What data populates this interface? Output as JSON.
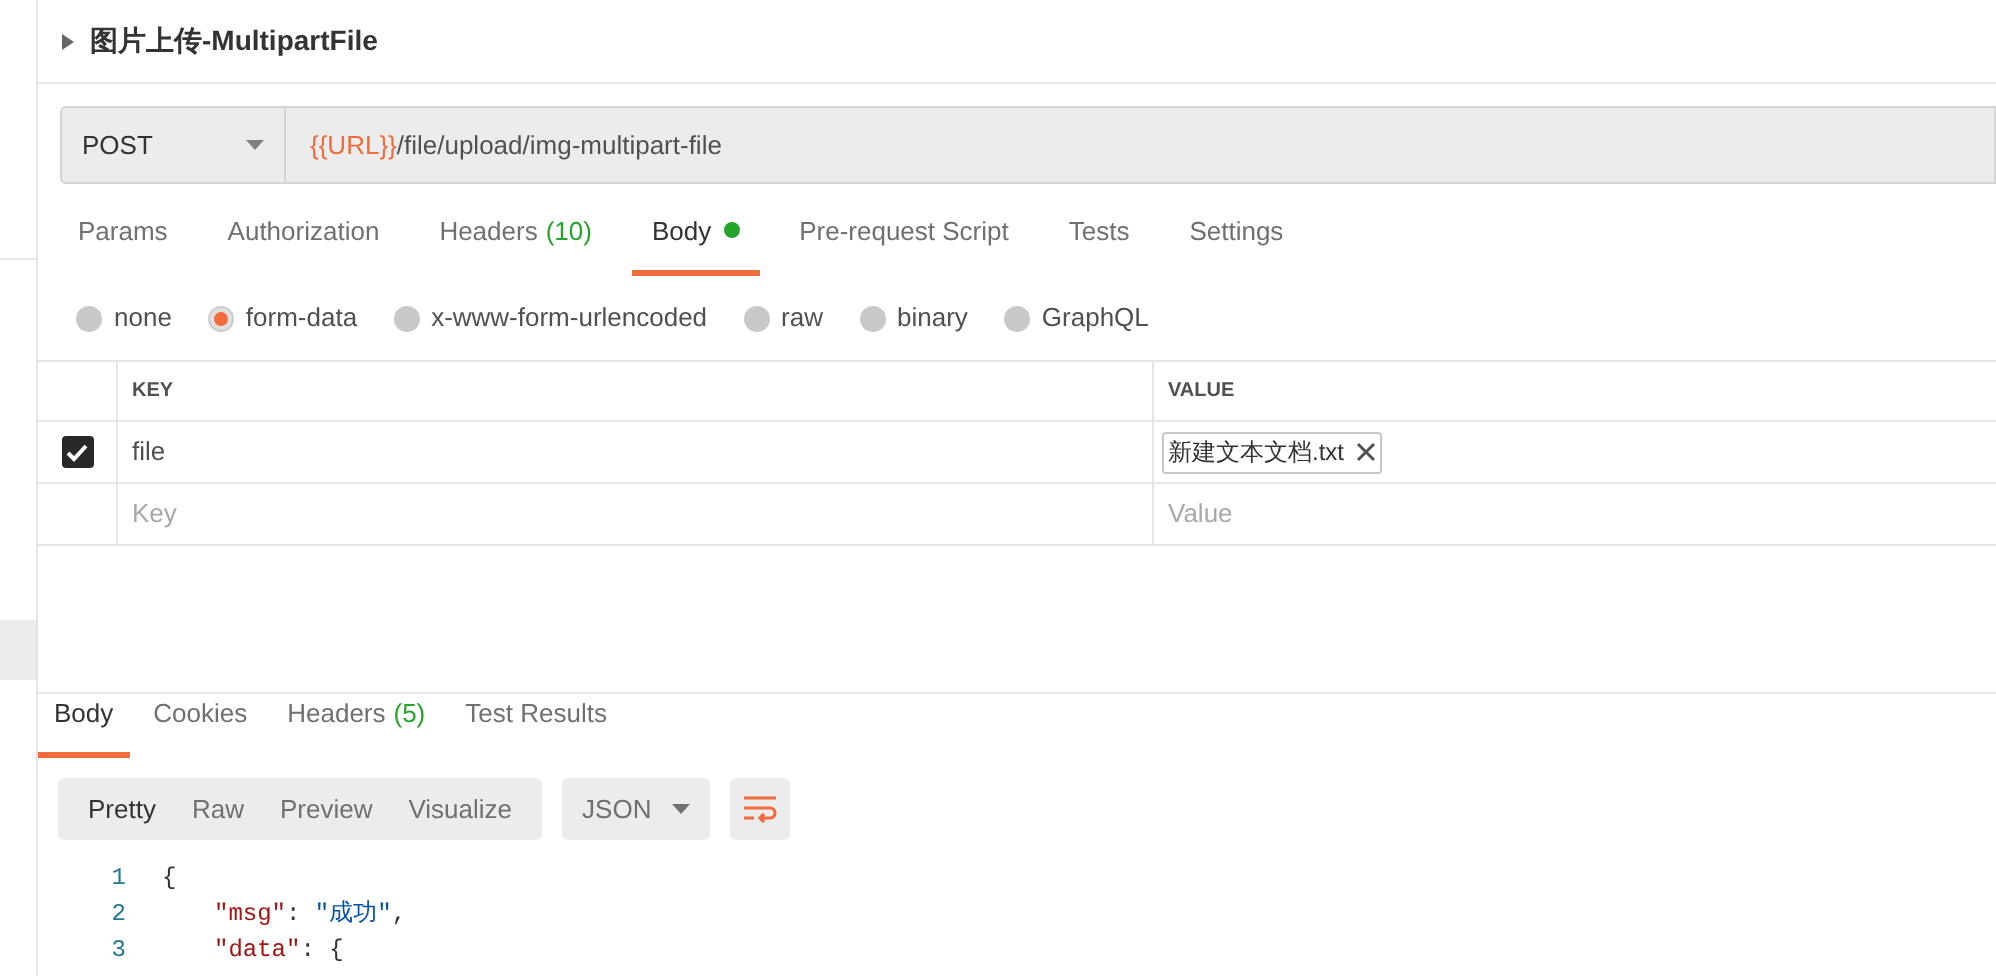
{
  "request": {
    "title": "图片上传-MultipartFile",
    "method": "POST",
    "url_variable": "{{URL}}",
    "url_path": "/file/upload/img-multipart-file"
  },
  "tabs": [
    {
      "label": "Params",
      "selected": false,
      "dot": false
    },
    {
      "label": "Authorization",
      "selected": false,
      "dot": false
    },
    {
      "label": "Headers",
      "count": "(10)",
      "selected": false,
      "dot": false
    },
    {
      "label": "Body",
      "selected": true,
      "dot": true
    },
    {
      "label": "Pre-request Script",
      "selected": false,
      "dot": false
    },
    {
      "label": "Tests",
      "selected": false,
      "dot": false
    },
    {
      "label": "Settings",
      "selected": false,
      "dot": false
    }
  ],
  "body_types": [
    {
      "label": "none",
      "selected": false
    },
    {
      "label": "form-data",
      "selected": true
    },
    {
      "label": "x-www-form-urlencoded",
      "selected": false
    },
    {
      "label": "raw",
      "selected": false
    },
    {
      "label": "binary",
      "selected": false
    },
    {
      "label": "GraphQL",
      "selected": false
    }
  ],
  "table": {
    "columns": [
      "KEY",
      "VALUE"
    ],
    "rows": [
      {
        "checked": true,
        "key": "file",
        "file": "新建文本文档.txt"
      }
    ],
    "new_row": {
      "key_placeholder": "Key",
      "value_placeholder": "Value"
    }
  },
  "response": {
    "tabs": [
      {
        "label": "Body",
        "selected": true
      },
      {
        "label": "Cookies",
        "selected": false
      },
      {
        "label": "Headers",
        "count": "(5)",
        "selected": false
      },
      {
        "label": "Test Results",
        "selected": false
      }
    ],
    "views": [
      {
        "label": "Pretty",
        "selected": true
      },
      {
        "label": "Raw",
        "selected": false
      },
      {
        "label": "Preview",
        "selected": false
      },
      {
        "label": "Visualize",
        "selected": false
      }
    ],
    "format": "JSON",
    "code": [
      {
        "number": "1",
        "tokens": [
          {
            "kind": "punct",
            "text": "{"
          }
        ]
      },
      {
        "number": "2",
        "tokens": [
          {
            "kind": "key",
            "text": "\"msg\""
          },
          {
            "kind": "punct",
            "text": ": "
          },
          {
            "kind": "string",
            "text": "\"成功\""
          },
          {
            "kind": "punct",
            "text": ","
          }
        ]
      },
      {
        "number": "3",
        "tokens": [
          {
            "kind": "key",
            "text": "\"data\""
          },
          {
            "kind": "punct",
            "text": ": {"
          }
        ]
      }
    ]
  }
}
